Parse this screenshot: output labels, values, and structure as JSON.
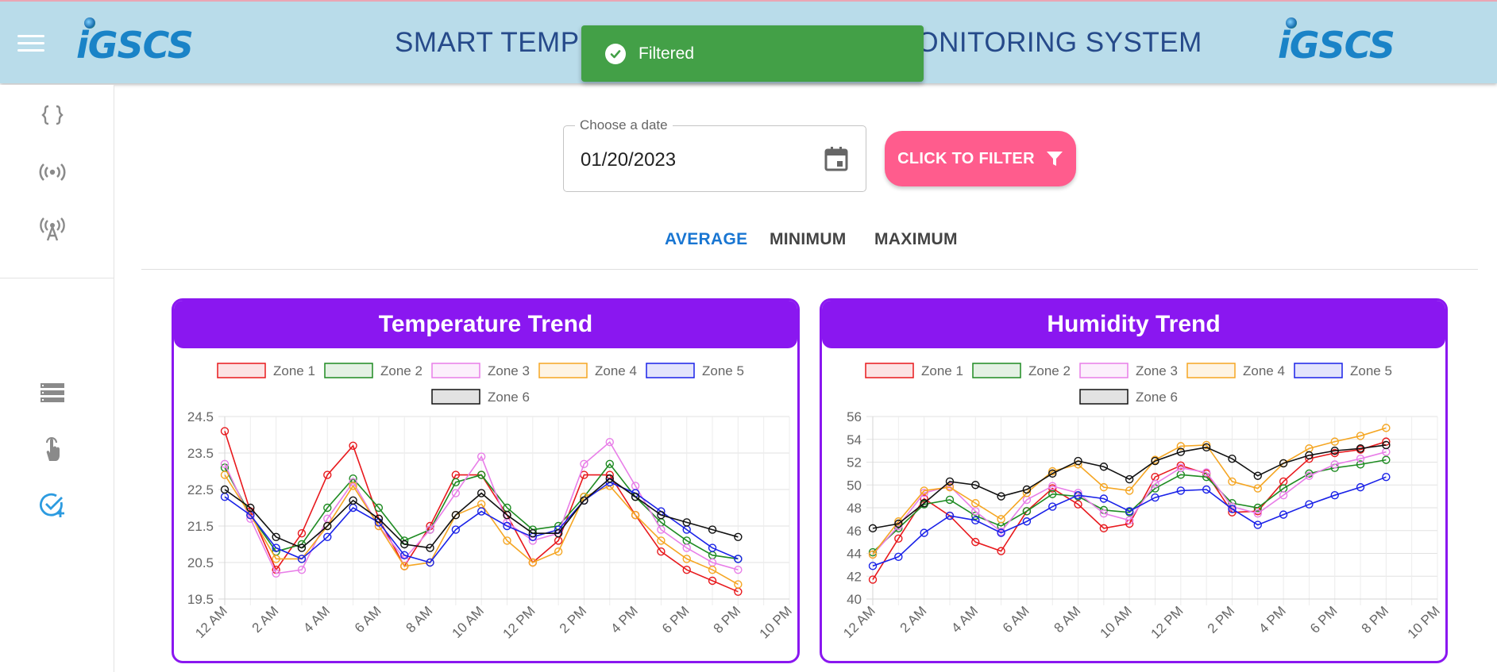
{
  "header": {
    "title": "SMART TEMPERATURE & HUMIDITY MONITORING SYSTEM",
    "logo_left": "iGSCS",
    "logo_right": "iGSCS"
  },
  "toast": {
    "message": "Filtered"
  },
  "sidebar": {
    "icons": [
      "braces-icon",
      "broadcast-icon",
      "antenna-icon",
      "storage-icon",
      "touch-icon",
      "check-add-icon"
    ]
  },
  "filter": {
    "date_label": "Choose a date",
    "date_value": "01/20/2023",
    "button_label": "CLICK TO FILTER"
  },
  "tabs": [
    {
      "label": "AVERAGE",
      "active": true
    },
    {
      "label": "MINIMUM",
      "active": false
    },
    {
      "label": "MAXIMUM",
      "active": false
    }
  ],
  "colors": {
    "accent": "#8a17f0",
    "toast": "#43a047",
    "button": "#ff5c8d",
    "tab_active": "#1976d2",
    "topbar": "#b9dcea"
  },
  "chart_data": [
    {
      "type": "line",
      "title": "Temperature Trend",
      "x": [
        "12 AM",
        "1 AM",
        "2 AM",
        "3 AM",
        "4 AM",
        "5 AM",
        "6 AM",
        "7 AM",
        "8 AM",
        "9 AM",
        "10 AM",
        "11 AM",
        "12 PM",
        "1 PM",
        "2 PM",
        "3 PM",
        "4 PM",
        "5 PM",
        "6 PM",
        "7 PM",
        "8 PM"
      ],
      "x_tick_labels": [
        "12 AM",
        "2 AM",
        "4 AM",
        "6 AM",
        "8 AM",
        "10 AM",
        "12 PM",
        "2 PM",
        "4 PM",
        "6 PM",
        "8 PM",
        "10 PM"
      ],
      "y_ticks": [
        "24.5",
        "23.5",
        "22.5",
        "21.5",
        "20.5",
        "19.5"
      ],
      "ylim": [
        19.5,
        24.5
      ],
      "grid": true,
      "legend": "top",
      "series": [
        {
          "name": "Zone 1",
          "color": "#e8191d",
          "values": [
            24.1,
            21.9,
            20.3,
            21.3,
            22.9,
            23.7,
            21.7,
            20.4,
            21.5,
            22.9,
            22.9,
            21.8,
            20.5,
            21.1,
            22.9,
            22.9,
            21.8,
            20.8,
            20.3,
            20.0,
            19.7
          ]
        },
        {
          "name": "Zone 2",
          "color": "#1e8b22",
          "values": [
            23.1,
            21.8,
            20.8,
            21.0,
            22.0,
            22.8,
            22.0,
            21.1,
            21.4,
            22.7,
            22.9,
            22.0,
            21.4,
            21.5,
            22.3,
            23.2,
            22.3,
            21.6,
            21.1,
            20.7,
            20.6
          ]
        },
        {
          "name": "Zone 3",
          "color": "#e87ee8",
          "values": [
            23.2,
            21.7,
            20.2,
            20.3,
            21.7,
            22.7,
            21.5,
            20.6,
            21.4,
            22.4,
            23.4,
            21.6,
            21.1,
            21.3,
            23.2,
            23.8,
            22.6,
            21.4,
            20.9,
            20.5,
            20.3
          ]
        },
        {
          "name": "Zone 4",
          "color": "#f5a623",
          "values": [
            22.9,
            21.8,
            20.6,
            20.6,
            21.5,
            22.6,
            21.5,
            20.4,
            20.5,
            21.8,
            22.1,
            21.1,
            20.5,
            20.8,
            22.3,
            22.6,
            21.8,
            21.1,
            20.6,
            20.3,
            19.9
          ]
        },
        {
          "name": "Zone 5",
          "color": "#1a22e8",
          "values": [
            22.3,
            21.8,
            20.9,
            20.6,
            21.2,
            22.0,
            21.6,
            20.7,
            20.5,
            21.4,
            21.9,
            21.5,
            21.2,
            21.4,
            22.2,
            22.7,
            22.4,
            21.9,
            21.4,
            20.9,
            20.6
          ]
        },
        {
          "name": "Zone 6",
          "color": "#111111",
          "values": [
            22.5,
            22.0,
            21.2,
            20.9,
            21.5,
            22.2,
            21.7,
            21.0,
            20.9,
            21.8,
            22.4,
            21.8,
            21.3,
            21.3,
            22.2,
            22.8,
            22.3,
            21.8,
            21.6,
            21.4,
            21.2
          ]
        }
      ]
    },
    {
      "type": "line",
      "title": "Humidity Trend",
      "x": [
        "12 AM",
        "1 AM",
        "2 AM",
        "3 AM",
        "4 AM",
        "5 AM",
        "6 AM",
        "7 AM",
        "8 AM",
        "9 AM",
        "10 AM",
        "11 AM",
        "12 PM",
        "1 PM",
        "2 PM",
        "3 PM",
        "4 PM",
        "5 PM",
        "6 PM",
        "7 PM",
        "8 PM"
      ],
      "x_tick_labels": [
        "12 AM",
        "2 AM",
        "4 AM",
        "6 AM",
        "8 AM",
        "10 AM",
        "12 PM",
        "2 PM",
        "4 PM",
        "6 PM",
        "8 PM",
        "10 PM"
      ],
      "y_ticks": [
        "56",
        "54",
        "52",
        "50",
        "48",
        "46",
        "44",
        "42",
        "40"
      ],
      "ylim": [
        40,
        56
      ],
      "grid": true,
      "legend": "top",
      "series": [
        {
          "name": "Zone 1",
          "color": "#e8191d",
          "values": [
            41.7,
            45.3,
            48.8,
            47.3,
            45.0,
            44.2,
            47.7,
            49.7,
            48.3,
            46.2,
            46.6,
            50.7,
            51.7,
            51.0,
            47.6,
            47.7,
            50.3,
            52.3,
            52.8,
            53.1,
            53.8
          ]
        },
        {
          "name": "Zone 2",
          "color": "#1e8b22",
          "values": [
            44.1,
            46.2,
            48.3,
            48.7,
            47.3,
            46.4,
            47.7,
            49.2,
            49.0,
            47.8,
            47.6,
            49.7,
            50.9,
            50.7,
            48.4,
            48.0,
            49.7,
            51.0,
            51.5,
            51.8,
            52.2
          ]
        },
        {
          "name": "Zone 3",
          "color": "#e87ee8",
          "values": [
            43.9,
            46.4,
            49.3,
            49.9,
            47.7,
            45.9,
            48.7,
            49.9,
            49.3,
            47.5,
            46.9,
            50.1,
            51.5,
            51.1,
            48.1,
            47.5,
            49.1,
            50.8,
            51.8,
            52.3,
            52.9
          ]
        },
        {
          "name": "Zone 4",
          "color": "#f5a623",
          "values": [
            43.9,
            46.8,
            49.5,
            49.8,
            48.4,
            47.0,
            49.3,
            51.2,
            51.8,
            49.8,
            49.5,
            52.2,
            53.4,
            53.5,
            50.3,
            49.7,
            51.9,
            53.2,
            53.8,
            54.3,
            55.0
          ]
        },
        {
          "name": "Zone 5",
          "color": "#1a22e8",
          "values": [
            42.9,
            43.7,
            45.8,
            47.3,
            46.9,
            45.8,
            46.8,
            48.1,
            49.1,
            48.8,
            47.7,
            48.9,
            49.5,
            49.6,
            47.9,
            46.5,
            47.4,
            48.3,
            49.1,
            49.8,
            50.7
          ]
        },
        {
          "name": "Zone 6",
          "color": "#111111",
          "values": [
            46.2,
            46.6,
            48.4,
            50.3,
            50.0,
            49.0,
            49.6,
            51.0,
            52.1,
            51.6,
            50.5,
            52.1,
            52.9,
            53.3,
            52.3,
            50.8,
            51.9,
            52.6,
            53.0,
            53.2,
            53.5
          ]
        }
      ]
    }
  ]
}
